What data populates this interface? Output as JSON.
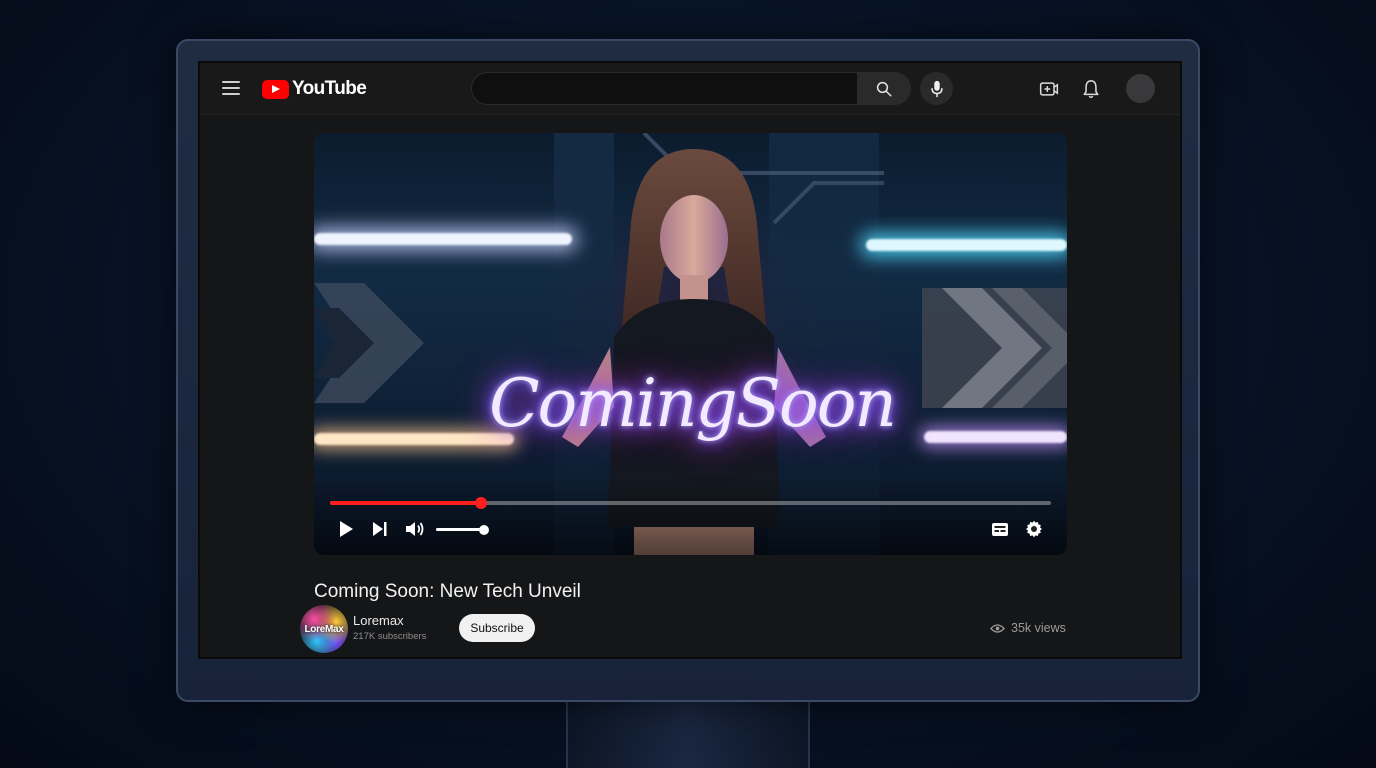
{
  "header": {
    "logo_text": "YouTube",
    "search_placeholder": "",
    "icons": [
      "menu-icon",
      "search-icon",
      "mic-icon",
      "create-icon",
      "bell-icon",
      "avatar"
    ]
  },
  "player": {
    "overlay_sign_text": "ComingSoon",
    "progress_fraction": 0.21,
    "volume_fraction": 0.95,
    "accent_color": "#ff1f1f"
  },
  "video": {
    "title": "Coming Soon: New Tech Unveil",
    "views": "35k views"
  },
  "channel": {
    "avatar_text": "LoreMax",
    "name": "Loremax",
    "subscribers": "217K subscribers",
    "subscribe_label": "Subscribe"
  }
}
